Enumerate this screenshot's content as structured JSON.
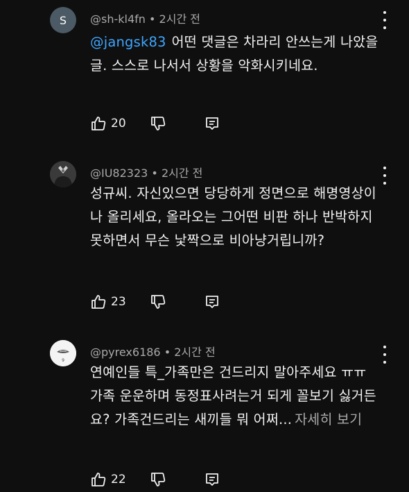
{
  "comments": [
    {
      "avatar_letter": "S",
      "author": "@sh-kl4fn",
      "time": "2시간 전",
      "mention": "@jangsk83",
      "text": "어떤 댓글은 차라리 안쓰는게 나았을 글. 스스로 나서서 상황을 악화시키네요.",
      "more": "",
      "likes": "20"
    },
    {
      "avatar_letter": "",
      "author": "@IU82323",
      "time": "2시간 전",
      "mention": "",
      "text": "성규씨. 자신있으면 당당하게 정면으로 해명영상이나 올리세요, 올라오는 그어떤 비판 하나 반박하지못하면서 무슨 낯짝으로 비아냥거립니까?",
      "more": "",
      "likes": "23"
    },
    {
      "avatar_letter": "",
      "author": "@pyrex6186",
      "time": "2시간 전",
      "mention": "",
      "text": "연예인들 특_가족만은 건드리지 말아주세요 ㅠㅠ 가족 운운하며 동정표사려는거 되게 꼴보기 싫거든요? 가족건드리는 새끼들 뭐 어쩌...",
      "more": "자세히 보기",
      "likes": "22"
    }
  ],
  "icons": {
    "like": "thumb-up-icon",
    "dislike": "thumb-down-icon",
    "reply": "reply-icon",
    "menu": "more-vert-icon"
  }
}
